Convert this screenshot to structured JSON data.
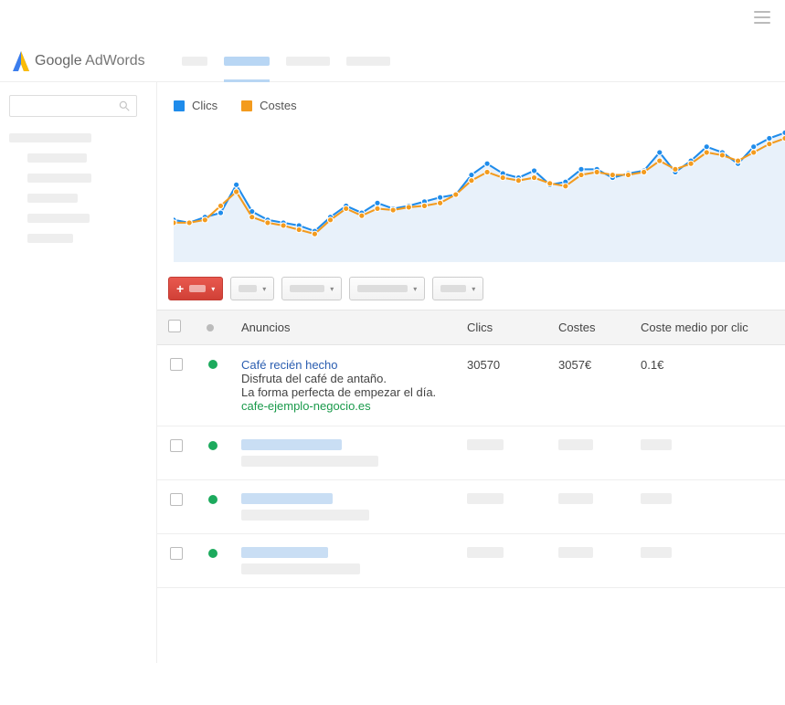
{
  "brand": {
    "name1": "Google",
    "name2": "AdWords"
  },
  "legend": {
    "clics": "Clics",
    "costes": "Costes"
  },
  "columns": {
    "anuncios": "Anuncios",
    "clics": "Clics",
    "costes": "Costes",
    "cpc": "Coste medio por clic"
  },
  "row1": {
    "title": "Café recién hecho",
    "line1": "Disfruta del café de antaño.",
    "line2": "La forma perfecta de empezar el día.",
    "url": "cafe-ejemplo-negocio.es",
    "clics": "30570",
    "costes": "3057€",
    "cpc": "0.1€"
  },
  "chart_data": {
    "type": "line",
    "x": [
      0,
      1,
      2,
      3,
      4,
      5,
      6,
      7,
      8,
      9,
      10,
      11,
      12,
      13,
      14,
      15,
      16,
      17,
      18,
      19,
      20,
      21,
      22,
      23,
      24,
      25,
      26,
      27,
      28,
      29,
      30,
      31,
      32,
      33,
      34,
      35,
      36,
      37,
      38,
      39
    ],
    "series": [
      {
        "name": "Clics",
        "color": "#1f8ceb",
        "values": [
          30,
          28,
          32,
          35,
          55,
          36,
          30,
          28,
          26,
          22,
          32,
          40,
          35,
          42,
          38,
          40,
          43,
          46,
          48,
          62,
          70,
          63,
          60,
          65,
          55,
          57,
          66,
          66,
          60,
          63,
          65,
          78,
          64,
          72,
          82,
          78,
          70,
          82,
          88,
          92
        ]
      },
      {
        "name": "Costes",
        "color": "#f39b1e",
        "values": [
          28,
          28,
          30,
          40,
          50,
          32,
          28,
          26,
          23,
          20,
          30,
          38,
          33,
          38,
          37,
          39,
          40,
          42,
          48,
          58,
          64,
          60,
          58,
          60,
          56,
          54,
          62,
          64,
          62,
          62,
          64,
          72,
          66,
          70,
          78,
          76,
          72,
          78,
          84,
          88
        ]
      }
    ],
    "ylim": [
      0,
      100
    ]
  }
}
